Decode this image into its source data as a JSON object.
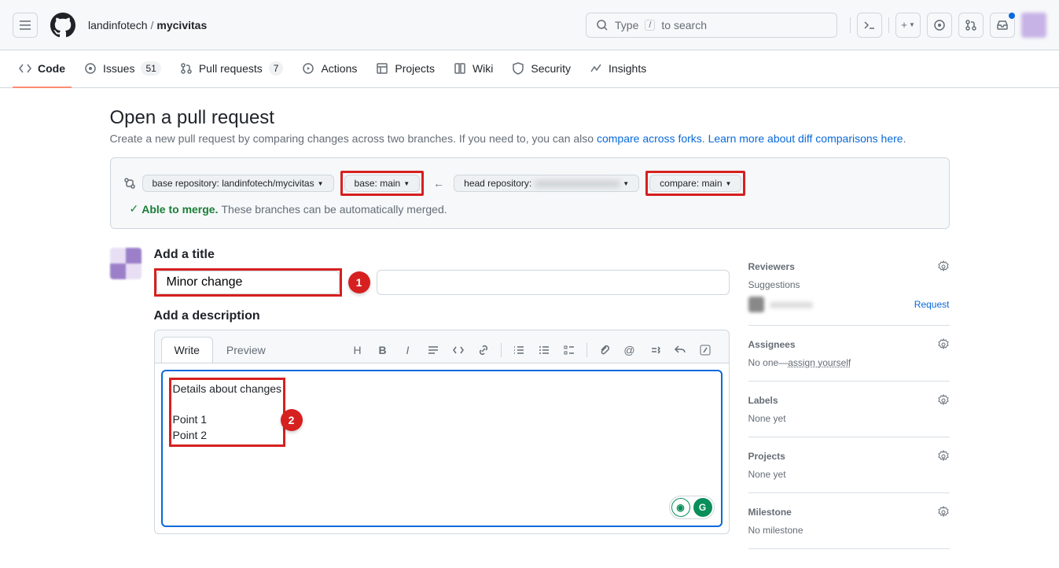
{
  "header": {
    "search_placeholder": "Type",
    "search_suffix": "to search",
    "search_key": "/"
  },
  "breadcrumb": {
    "owner": "landinfotech",
    "repo": "mycivitas"
  },
  "nav": {
    "code": "Code",
    "issues": "Issues",
    "issues_count": "51",
    "pulls": "Pull requests",
    "pulls_count": "7",
    "actions": "Actions",
    "projects": "Projects",
    "wiki": "Wiki",
    "security": "Security",
    "insights": "Insights"
  },
  "page": {
    "title": "Open a pull request",
    "desc_start": "Create a new pull request by comparing changes across two branches. If you need to, you can also ",
    "link1": "compare across forks",
    "desc_mid": ". ",
    "link2": "Learn more about diff comparisons here",
    "desc_end": "."
  },
  "compare": {
    "base_repo_label": "base repository: landinfotech/mycivitas",
    "base_branch": "base: main",
    "head_repo_label": "head repository:",
    "head_repo_value": "xxxxxxxxxxxxxxxxxx",
    "compare_branch": "compare: main",
    "merge_ok": "Able to merge.",
    "merge_msg": "These branches can be automatically merged."
  },
  "form": {
    "title_label": "Add a title",
    "title_value": "Minor change",
    "desc_label": "Add a description",
    "tab_write": "Write",
    "tab_preview": "Preview",
    "desc_value": "Details about changes\n\nPoint 1\nPoint 2"
  },
  "annotations": {
    "a1": "1",
    "a2": "2"
  },
  "sidebar": {
    "reviewers": "Reviewers",
    "suggestions": "Suggestions",
    "request": "Request",
    "assignees": "Assignees",
    "noone": "No one—",
    "assign_yourself": "assign yourself",
    "labels": "Labels",
    "none_yet": "None yet",
    "projects": "Projects",
    "milestone": "Milestone",
    "no_milestone": "No milestone"
  }
}
